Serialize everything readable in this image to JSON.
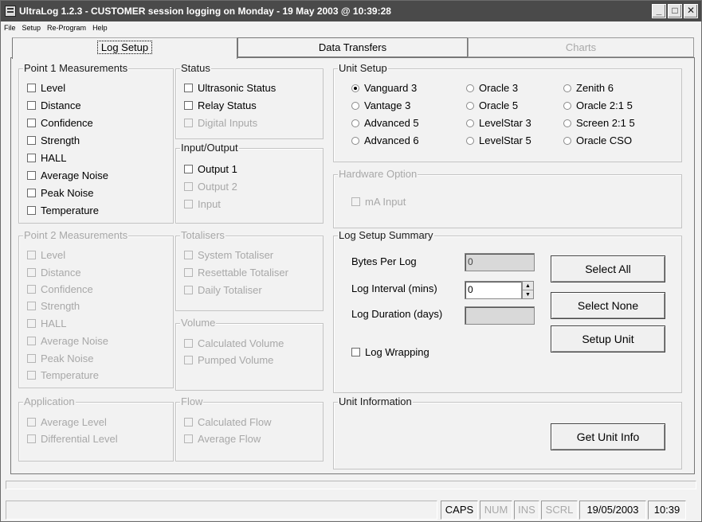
{
  "window": {
    "title": "UltraLog 1.2.3 - CUSTOMER session logging on Monday - 19 May 2003 @ 10:39:28"
  },
  "menu": [
    "File",
    "Setup",
    "Re-Program",
    "Help"
  ],
  "tabs": {
    "log_setup": "Log Setup",
    "data_transfers": "Data Transfers",
    "charts": "Charts"
  },
  "point1": {
    "title": "Point 1 Measurements",
    "items": [
      "Level",
      "Distance",
      "Confidence",
      "Strength",
      "HALL",
      "Average Noise",
      "Peak Noise",
      "Temperature"
    ]
  },
  "point2": {
    "title": "Point 2 Measurements",
    "items": [
      "Level",
      "Distance",
      "Confidence",
      "Strength",
      "HALL",
      "Average Noise",
      "Peak Noise",
      "Temperature"
    ]
  },
  "application": {
    "title": "Application",
    "items": [
      "Average Level",
      "Differential Level"
    ]
  },
  "status": {
    "title": "Status",
    "items": [
      "Ultrasonic Status",
      "Relay Status",
      "Digital Inputs"
    ]
  },
  "io": {
    "title": "Input/Output",
    "items": [
      "Output 1",
      "Output 2",
      "Input"
    ]
  },
  "totalisers": {
    "title": "Totalisers",
    "items": [
      "System Totaliser",
      "Resettable Totaliser",
      "Daily Totaliser"
    ]
  },
  "volume": {
    "title": "Volume",
    "items": [
      "Calculated Volume",
      "Pumped Volume"
    ]
  },
  "flow": {
    "title": "Flow",
    "items": [
      "Calculated Flow",
      "Average Flow"
    ]
  },
  "unit_setup": {
    "title": "Unit Setup",
    "options": [
      "Vanguard 3",
      "Vantage 3",
      "Advanced 5",
      "Advanced 6",
      "Oracle 3",
      "Oracle 5",
      "LevelStar 3",
      "LevelStar 5",
      "Zenith 6",
      "Oracle 2:1 5",
      "Screen 2:1 5",
      "Oracle CSO"
    ],
    "selected": "Vanguard 3"
  },
  "hardware": {
    "title": "Hardware Option",
    "items": [
      "mA Input"
    ]
  },
  "summary": {
    "title": "Log Setup Summary",
    "bytes_label": "Bytes Per Log",
    "bytes_value": "0",
    "interval_label": "Log Interval (mins)",
    "interval_value": "0",
    "duration_label": "Log Duration (days)",
    "duration_value": "",
    "wrapping_label": "Log Wrapping",
    "select_all": "Select All",
    "select_none": "Select None",
    "setup_unit": "Setup Unit"
  },
  "unit_info": {
    "title": "Unit Information",
    "button": "Get Unit Info"
  },
  "statusbar": {
    "caps": "CAPS",
    "num": "NUM",
    "ins": "INS",
    "scrl": "SCRL",
    "date": "19/05/2003",
    "time": "10:39"
  }
}
